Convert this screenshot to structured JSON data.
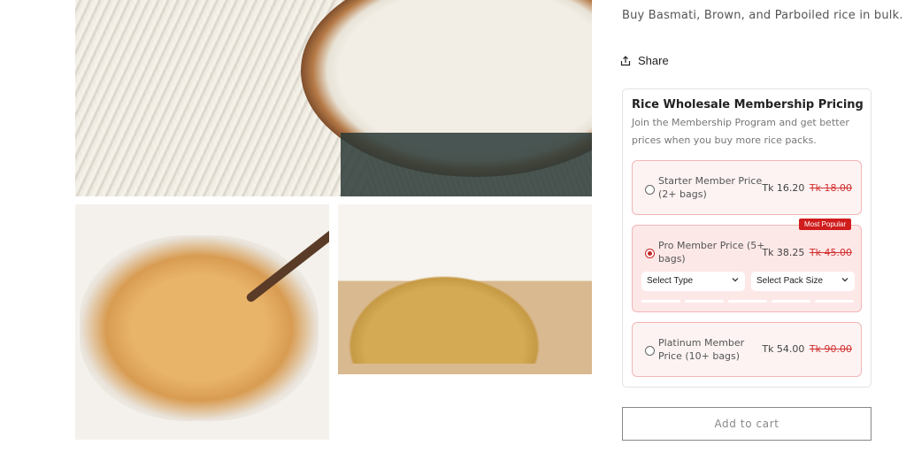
{
  "product": {
    "subtitle": "Buy Basmati, Brown, and Parboiled rice in bulk.",
    "share_label": "Share",
    "images": [
      {
        "icon": "rice-bowl-image"
      },
      {
        "icon": "brown-rice-bowl-image"
      },
      {
        "icon": "parboiled-rice-pile-image"
      }
    ]
  },
  "membership": {
    "title": "Rice Wholesale Membership Pricing",
    "description": "Join the Membership Program and get better prices when you buy more rice packs.",
    "tiers": [
      {
        "name": "Starter Member Price (2+ bags)",
        "price": "Tk 16.20",
        "old_price": "Tk 18.00",
        "selected": false
      },
      {
        "name": "Pro Member Price (5+ bags)",
        "price": "Tk 38.25",
        "old_price": "Tk 45.00",
        "selected": true,
        "badge": "Most Popular"
      },
      {
        "name": "Platinum Member Price (10+ bags)",
        "price": "Tk 54.00",
        "old_price": "Tk 90.00",
        "selected": false
      }
    ],
    "select_type": "Select Type",
    "select_pack": "Select Pack Size"
  },
  "add_to_cart": "Add to cart",
  "colors": {
    "accent": "#d01c1c",
    "tier_bg": "#fde8e8",
    "tier_border": "#f2b6b6"
  }
}
